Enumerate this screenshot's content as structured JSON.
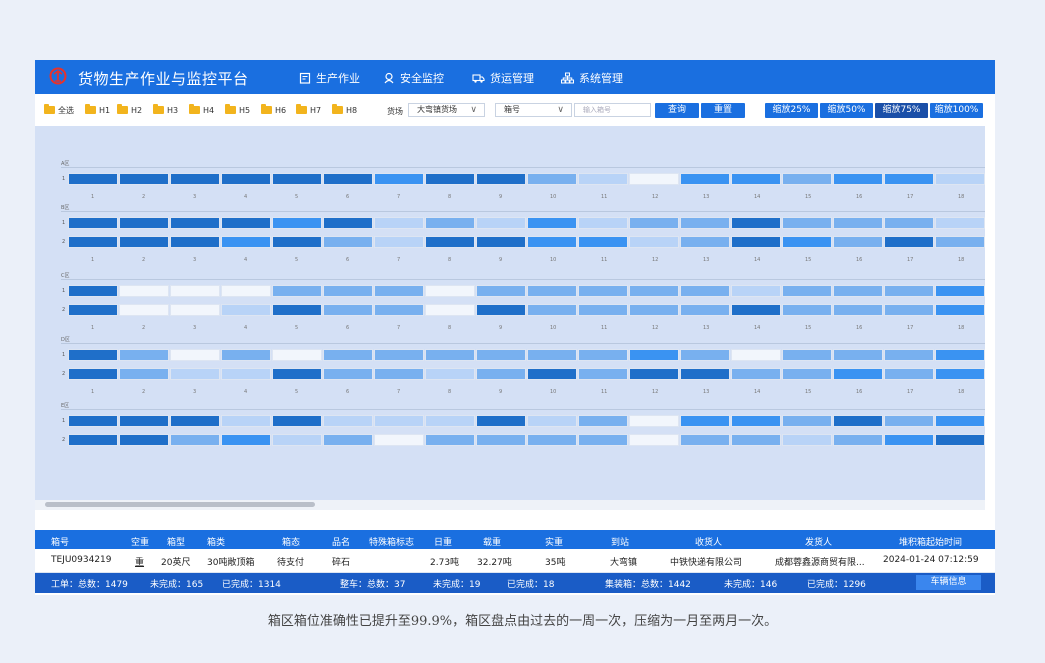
{
  "app": {
    "title": "货物生产作业与监控平台"
  },
  "nav": [
    {
      "label": "生产作业",
      "icon": "clipboard-icon"
    },
    {
      "label": "安全监控",
      "icon": "shield-person-icon"
    },
    {
      "label": "货运管理",
      "icon": "truck-icon"
    },
    {
      "label": "系统管理",
      "icon": "network-icon"
    }
  ],
  "toolbar": {
    "folders": [
      "全选",
      "H1",
      "H2",
      "H3",
      "H4",
      "H5",
      "H6",
      "H7",
      "H8"
    ],
    "yard_label": "货场",
    "yard_value": "大弯镇货场",
    "box_select": "箱号",
    "box_placeholder": "输入箱号",
    "query": "查询",
    "reset": "重置",
    "zoom": [
      "缩放25%",
      "缩放50%",
      "缩放75%",
      "缩放100%"
    ],
    "zoom_selected": "缩放75%"
  },
  "yard": {
    "colors": {
      "l1": "#f2f6fc",
      "l2": "#b8d3f7",
      "l3": "#78b0ef",
      "l4": "#3a93f2",
      "l5": "#1f6fc9"
    },
    "zones": [
      {
        "name": "A区",
        "rows": [
          [
            5,
            5,
            5,
            5,
            5,
            5,
            4,
            5,
            5,
            3,
            2,
            1,
            4,
            4,
            3,
            4,
            4,
            2
          ]
        ]
      },
      {
        "name": "B区",
        "rows": [
          [
            5,
            5,
            5,
            5,
            4,
            5,
            2,
            3,
            2,
            4,
            2,
            3,
            3,
            5,
            3,
            3,
            3,
            2
          ],
          [
            5,
            5,
            5,
            4,
            5,
            3,
            2,
            5,
            5,
            4,
            4,
            2,
            3,
            5,
            4,
            3,
            5,
            3
          ]
        ]
      },
      {
        "name": "C区",
        "rows": [
          [
            5,
            1,
            1,
            1,
            3,
            3,
            3,
            1,
            3,
            3,
            3,
            3,
            3,
            2,
            3,
            3,
            3,
            4
          ],
          [
            5,
            1,
            1,
            2,
            5,
            3,
            3,
            1,
            5,
            3,
            3,
            3,
            3,
            5,
            3,
            3,
            3,
            4
          ]
        ]
      },
      {
        "name": "D区",
        "rows": [
          [
            5,
            3,
            1,
            3,
            1,
            3,
            3,
            3,
            3,
            3,
            3,
            4,
            3,
            1,
            3,
            3,
            3,
            4
          ],
          [
            5,
            3,
            2,
            2,
            5,
            3,
            3,
            2,
            3,
            5,
            3,
            5,
            5,
            3,
            3,
            4,
            3,
            4
          ]
        ]
      },
      {
        "name": "E区",
        "rows": [
          [
            5,
            5,
            5,
            2,
            5,
            2,
            2,
            2,
            5,
            2,
            3,
            1,
            4,
            4,
            3,
            5,
            3,
            4
          ],
          [
            5,
            5,
            3,
            4,
            2,
            3,
            1,
            3,
            3,
            3,
            3,
            1,
            3,
            3,
            2,
            3,
            4,
            5
          ]
        ]
      }
    ],
    "col_numbers": [
      "1",
      "2",
      "3",
      "4",
      "5",
      "6",
      "7",
      "8",
      "9",
      "10",
      "11",
      "12",
      "13",
      "14",
      "15",
      "16",
      "17",
      "18"
    ]
  },
  "table": {
    "headers": [
      "箱号",
      "空重",
      "箱型",
      "箱类",
      "箱态",
      "品名",
      "特殊箱标志",
      "日重",
      "载重",
      "实重",
      "到站",
      "收货人",
      "发货人",
      "堆积箱起始时间"
    ],
    "row": [
      "TEJU0934219",
      "重",
      "20英尺",
      "30吨敞顶箱",
      "待支付",
      "碎石",
      "",
      "2.73吨",
      "32.27吨",
      "35吨",
      "大弯镇",
      "中铁快递有限公司",
      "成都蓉鑫源商贸有限...",
      "2024-01-24 07:12:59"
    ]
  },
  "status": {
    "work_total": "工单：总数：1479",
    "work_pending": "未完成：165",
    "work_done": "已完成：1314",
    "car_total": "整车：总数：37",
    "car_pending": "未完成：19",
    "car_done": "已完成：18",
    "box_total": "集装箱：总数：1442",
    "box_pending": "未完成：146",
    "box_done": "已完成：1296",
    "vehicle_btn": "车辆信息"
  },
  "caption": "箱区箱位准确性已提升至99.9%，箱区盘点由过去的一周一次，压缩为一月至两月一次。"
}
